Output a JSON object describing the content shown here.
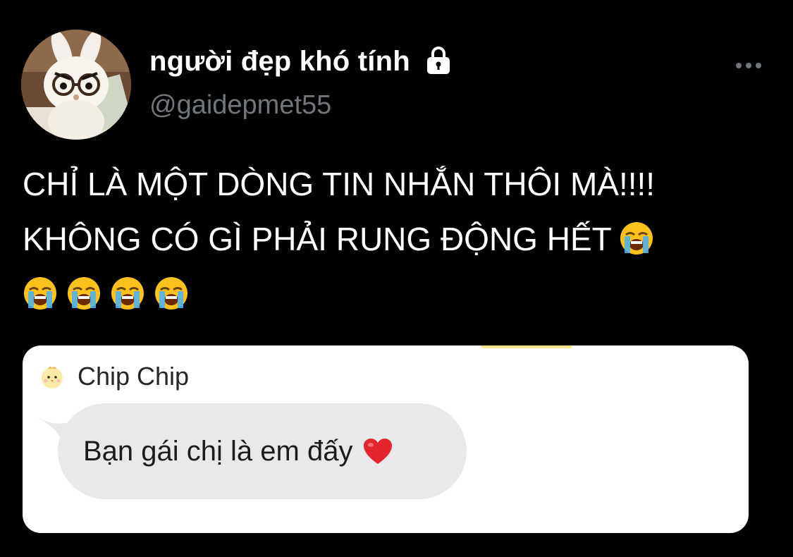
{
  "author": {
    "display_name": "người đẹp khó tính",
    "handle": "@gaidepmet55",
    "protected_icon": "lock-icon",
    "avatar_icon": "bunny-avatar"
  },
  "actions": {
    "more_icon": "more-horizontal-icon"
  },
  "tweet": {
    "line1": "CHỈ LÀ MỘT DÒNG TIN NHẮN THÔI MÀ!!!!",
    "line2": "KHÔNG CÓ GÌ PHẢI RUNG ĐỘNG HẾT",
    "emoji_name": "loudly-crying-face",
    "line3_emoji_count": 4
  },
  "media": {
    "sender_name": "Chip Chip",
    "sender_avatar_icon": "chick-avatar",
    "message_text": "Bạn gái chị là em đấy",
    "message_emoji": "red-heart-icon"
  },
  "colors": {
    "background": "#000000",
    "text_primary": "#ffffff",
    "text_secondary": "#71767b",
    "bubble": "#e9e9eb",
    "card": "#ffffff"
  }
}
